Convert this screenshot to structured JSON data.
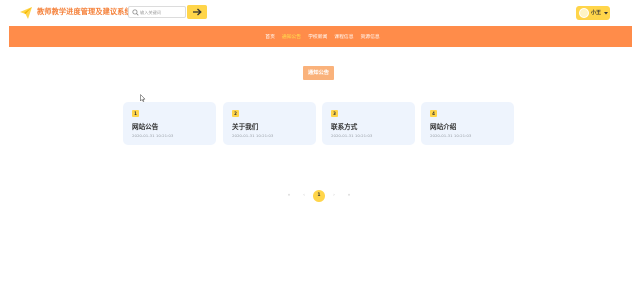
{
  "header": {
    "site_title": "教师教学进度管理及建议系统",
    "search_placeholder": "输入关键词",
    "user_name": "小王",
    "accent_color": "#ffd54a",
    "brand_color": "#f5813a"
  },
  "nav": {
    "bg_color": "#ff8c4a",
    "items": [
      {
        "label": "首页",
        "active": false
      },
      {
        "label": "通知公告",
        "active": true
      },
      {
        "label": "学校新闻",
        "active": false
      },
      {
        "label": "课程信息",
        "active": false
      },
      {
        "label": "资源信息",
        "active": false
      }
    ]
  },
  "main": {
    "section_title": "通知公告",
    "cards": [
      {
        "num": "1",
        "title": "网站公告",
        "date": "2020-01-31 10:21:03"
      },
      {
        "num": "2",
        "title": "关于我们",
        "date": "2020-01-31 10:21:03"
      },
      {
        "num": "3",
        "title": "联系方式",
        "date": "2020-01-31 10:21:03"
      },
      {
        "num": "4",
        "title": "网站介绍",
        "date": "2020-01-31 10:21:03"
      }
    ]
  },
  "pagination": {
    "first": "«",
    "prev": "‹",
    "current": "1",
    "next": "›",
    "last": "»"
  },
  "icons": {
    "logo": "paper-plane-icon",
    "search": "search-icon",
    "search_button": "arrow-right-icon",
    "user_dropdown": "caret-down-icon",
    "cursor": "mouse-cursor-icon"
  }
}
